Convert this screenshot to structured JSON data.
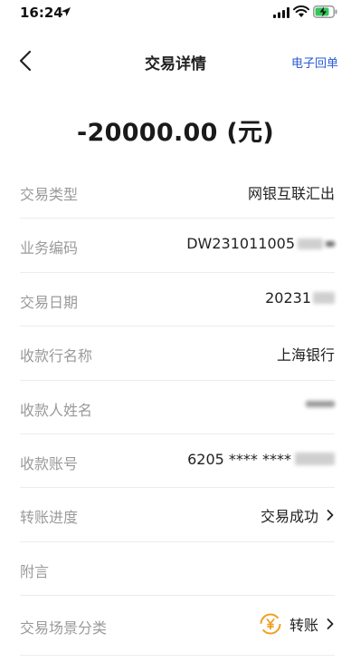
{
  "status": {
    "time": "16:24"
  },
  "nav": {
    "title": "交易详情",
    "action": "电子回单"
  },
  "amount": "-20000.00 (元)",
  "rows": [
    {
      "label": "交易类型",
      "value": "网银互联汇出"
    },
    {
      "label": "业务编码",
      "value": "DW231011005"
    },
    {
      "label": "交易日期",
      "value": "20231"
    },
    {
      "label": "收款行名称",
      "value": "上海银行"
    },
    {
      "label": "收款人姓名",
      "value": ""
    },
    {
      "label": "收款账号",
      "value": "6205 **** ****"
    },
    {
      "label": "转账进度",
      "value": "交易成功"
    },
    {
      "label": "附言",
      "value": ""
    },
    {
      "label": "交易场景分类",
      "value": "转账"
    }
  ],
  "colors": {
    "link": "#2b5bd6",
    "label": "#9a9a9a",
    "scene_icon": "#f0a020"
  },
  "icons": [
    "location-arrow-icon",
    "signal-icon",
    "wifi-icon",
    "battery-charging-icon",
    "chevron-left-icon",
    "chevron-right-icon",
    "yuan-exchange-icon"
  ]
}
